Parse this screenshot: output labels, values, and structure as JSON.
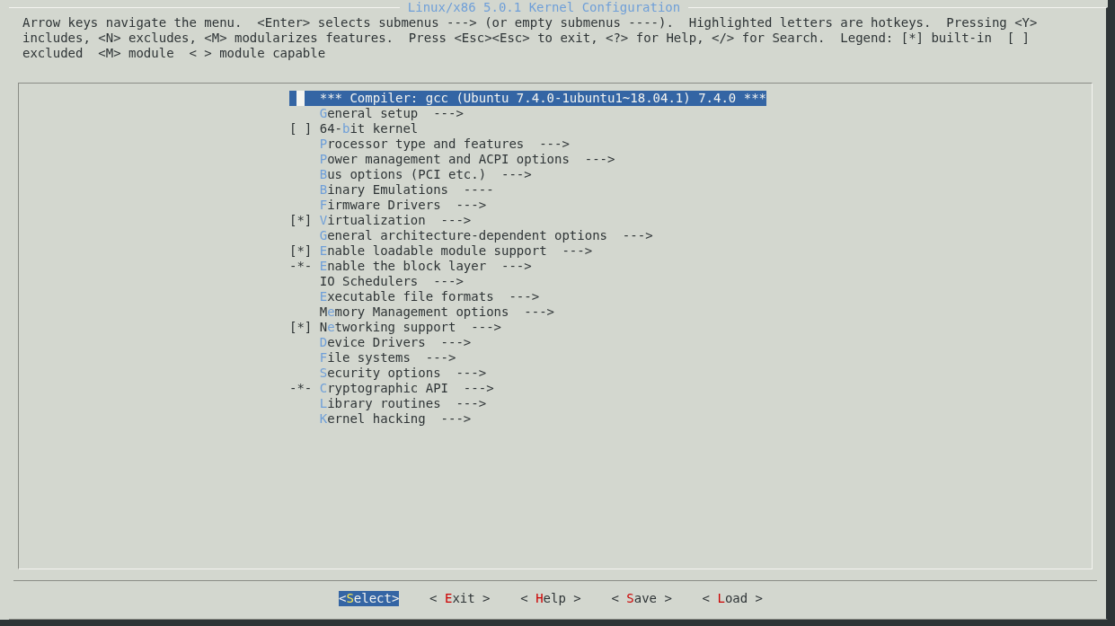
{
  "window": {
    "title": "Linux/x86 5.0.1 Kernel Configuration"
  },
  "help_text": [
    "Arrow keys navigate the menu.  <Enter> selects submenus ---> (or empty submenus ----).  Highlighted letters are hotkeys.  Pressing <Y>",
    "includes, <N> excludes, <M> modularizes features.  Press <Esc><Esc> to exit, <?> for Help, </> for Search.  Legend: [*] built-in  [ ]",
    "excluded  <M> module  < > module capable"
  ],
  "menu": [
    {
      "kind": "comment",
      "label": "*** Compiler: gcc (Ubuntu 7.4.0-1ubuntu1~18.04.1) 7.4.0 ***",
      "selected": true
    },
    {
      "kind": "entry",
      "label": "**G**eneral setup  --->",
      "selected": false
    },
    {
      "kind": "entry",
      "prefix": "[ ]",
      "label": "64-**b**it kernel",
      "selected": false
    },
    {
      "kind": "entry",
      "label": "**P**rocessor type and features  --->",
      "selected": false
    },
    {
      "kind": "entry",
      "label": "**P**ower management and ACPI options  --->",
      "selected": false
    },
    {
      "kind": "entry",
      "label": "**B**us options (PCI etc.)  --->",
      "selected": false
    },
    {
      "kind": "entry",
      "label": "**B**inary Emulations  ----",
      "selected": false
    },
    {
      "kind": "entry",
      "label": "**F**irmware Drivers  --->",
      "selected": false
    },
    {
      "kind": "entry",
      "prefix": "[*]",
      "label": "**V**irtualization  --->",
      "selected": false
    },
    {
      "kind": "entry",
      "label": "**G**eneral architecture-dependent options  --->",
      "selected": false
    },
    {
      "kind": "entry",
      "prefix": "[*]",
      "label": "**E**nable loadable module support  --->",
      "selected": false
    },
    {
      "kind": "entry",
      "prefix": "-*-",
      "label": "**E**nable the block layer  --->",
      "selected": false
    },
    {
      "kind": "entry",
      "label": "IO Schedulers  --->",
      "selected": false
    },
    {
      "kind": "entry",
      "label": "**E**xecutable file formats  --->",
      "selected": false
    },
    {
      "kind": "entry",
      "label": "M**e**mory Management options  --->",
      "selected": false
    },
    {
      "kind": "entry",
      "prefix": "[*]",
      "label": "N**e**tworking support  --->",
      "selected": false
    },
    {
      "kind": "entry",
      "label": "**D**evice Drivers  --->",
      "selected": false
    },
    {
      "kind": "entry",
      "label": "**F**ile systems  --->",
      "selected": false
    },
    {
      "kind": "entry",
      "label": "**S**ecurity options  --->",
      "selected": false
    },
    {
      "kind": "entry",
      "prefix": "-*-",
      "label": "**C**ryptographic API  --->",
      "selected": false
    },
    {
      "kind": "entry",
      "label": "**L**ibrary routines  --->",
      "selected": false
    },
    {
      "kind": "entry",
      "label": "**K**ernel hacking  --->",
      "selected": false
    }
  ],
  "buttons": [
    {
      "label": "<**S**elect>",
      "selected": true
    },
    {
      "label": "< **E**xit >",
      "selected": false
    },
    {
      "label": "< **H**elp >",
      "selected": false
    },
    {
      "label": "< **S**ave >",
      "selected": false
    },
    {
      "label": "< **L**oad >",
      "selected": false
    }
  ]
}
